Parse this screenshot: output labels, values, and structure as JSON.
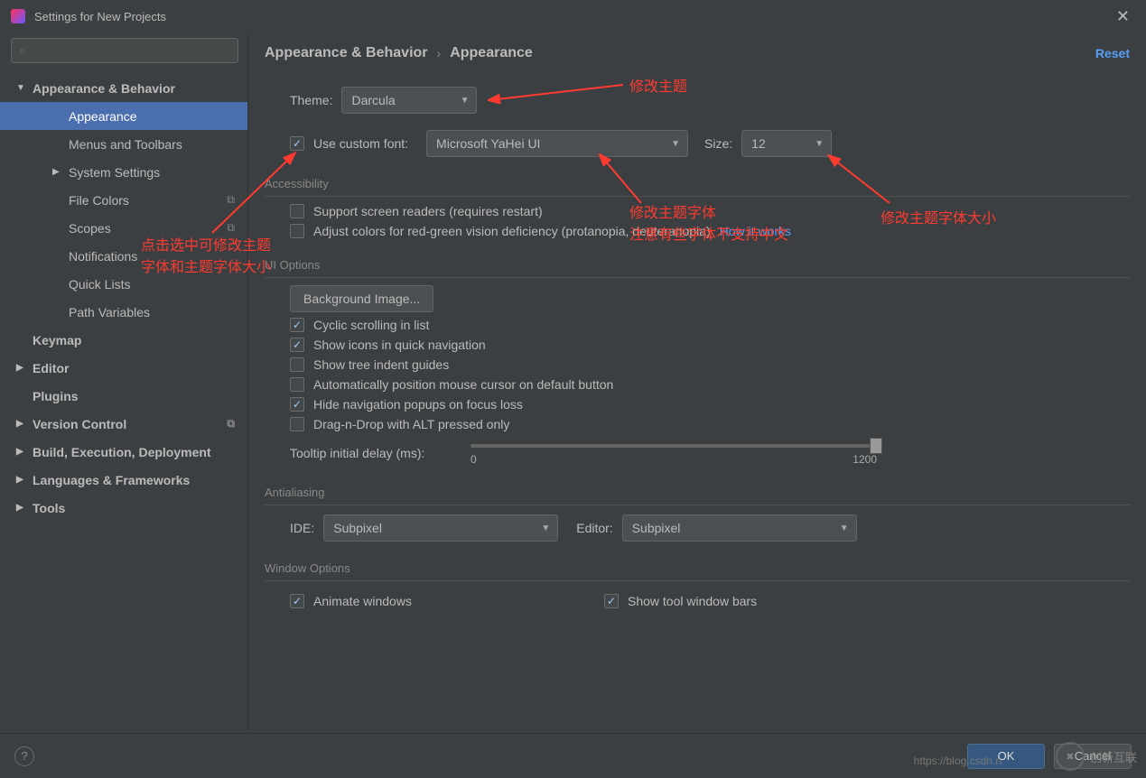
{
  "window": {
    "title": "Settings for New Projects"
  },
  "search": {
    "placeholder": ""
  },
  "reset_label": "Reset",
  "sidebar": {
    "items": [
      {
        "label": "Appearance & Behavior",
        "expandable": true,
        "open": true,
        "level": 1
      },
      {
        "label": "Appearance",
        "level": 2,
        "selected": true
      },
      {
        "label": "Menus and Toolbars",
        "level": 2
      },
      {
        "label": "System Settings",
        "level": 2,
        "expandable": true
      },
      {
        "label": "File Colors",
        "level": 2,
        "badge": "⧉"
      },
      {
        "label": "Scopes",
        "level": 2,
        "badge": "⧉"
      },
      {
        "label": "Notifications",
        "level": 2
      },
      {
        "label": "Quick Lists",
        "level": 2
      },
      {
        "label": "Path Variables",
        "level": 2
      },
      {
        "label": "Keymap",
        "level": 1
      },
      {
        "label": "Editor",
        "level": 1,
        "expandable": true
      },
      {
        "label": "Plugins",
        "level": 1
      },
      {
        "label": "Version Control",
        "level": 1,
        "expandable": true,
        "badge": "⧉"
      },
      {
        "label": "Build, Execution, Deployment",
        "level": 1,
        "expandable": true
      },
      {
        "label": "Languages & Frameworks",
        "level": 1,
        "expandable": true
      },
      {
        "label": "Tools",
        "level": 1,
        "expandable": true
      }
    ]
  },
  "breadcrumb": {
    "a": "Appearance & Behavior",
    "b": "Appearance"
  },
  "theme": {
    "label": "Theme:",
    "value": "Darcula"
  },
  "font": {
    "use_custom": "Use custom font:",
    "family": "Microsoft YaHei UI",
    "size_label": "Size:",
    "size": "12"
  },
  "accessibility": {
    "title": "Accessibility",
    "screen_readers": "Support screen readers (requires restart)",
    "color_def": "Adjust colors for red-green vision deficiency (protanopia, deuteranopia)",
    "how": "How it works"
  },
  "ui_opts": {
    "title": "UI Options",
    "bg_image": "Background Image...",
    "cyclic": "Cyclic scrolling in list",
    "icons": "Show icons in quick navigation",
    "tree_ind": "Show tree indent guides",
    "auto_cursor": "Automatically position mouse cursor on default button",
    "hide_nav": "Hide navigation popups on focus loss",
    "dnd_alt": "Drag-n-Drop with ALT pressed only",
    "tooltip_label": "Tooltip initial delay (ms):",
    "tooltip_min": "0",
    "tooltip_max": "1200"
  },
  "aa": {
    "title": "Antialiasing",
    "ide_label": "IDE:",
    "ide_val": "Subpixel",
    "ed_label": "Editor:",
    "ed_val": "Subpixel"
  },
  "window_opts": {
    "title": "Window Options",
    "animate": "Animate windows",
    "toolbars": "Show tool window bars"
  },
  "footer": {
    "ok": "OK",
    "cancel": "Cancel"
  },
  "annotations": {
    "theme": "修改主题",
    "font": "修改主题字体\n注意有些字体不支持中文",
    "size": "修改主题字体大小",
    "check": "点击选中可修改主题\n字体和主题字体大小"
  },
  "watermark": {
    "url": "https://blog.csdn.n",
    "brand": "创新互联"
  }
}
